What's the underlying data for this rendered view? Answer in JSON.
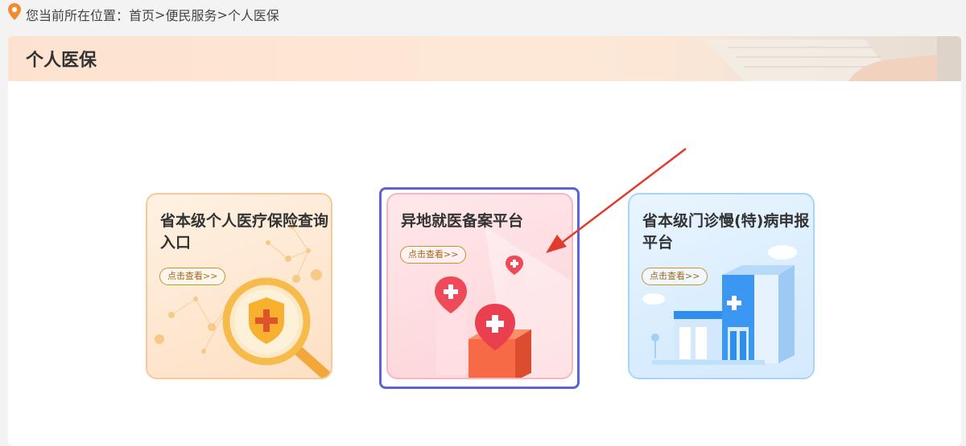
{
  "breadcrumb": {
    "prefix": "您当前所在位置：",
    "items": [
      "首页",
      "便民服务",
      "个人医保"
    ],
    "separator": ">"
  },
  "panel": {
    "title": "个人医保"
  },
  "cards": [
    {
      "title": "省本级个人医疗保险查询入口",
      "button": "点击查看>>",
      "theme": "orange",
      "icon": "shield-magnifier-icon"
    },
    {
      "title": "异地就医备案平台",
      "button": "点击查看>>",
      "theme": "pink",
      "icon": "medical-location-pins-icon",
      "highlighted": true
    },
    {
      "title": "省本级门诊慢(特)病申报平台",
      "button": "点击查看>>",
      "theme": "blue",
      "icon": "hospital-building-icon"
    }
  ],
  "colors": {
    "highlight_frame": "#5b63d9",
    "annotation_arrow": "#e23b2e"
  }
}
